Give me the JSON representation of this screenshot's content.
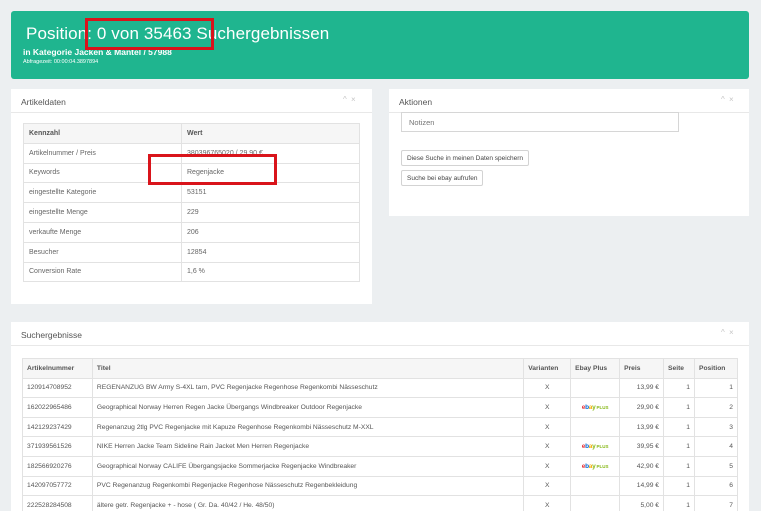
{
  "header": {
    "title": "Position: 0 von 35463 Suchergebnissen",
    "subtitle": "in Kategorie Jacken & Mäntel / 57988",
    "time": "Abfragezeit: 00:00:04.3897894"
  },
  "artikeldaten": {
    "title": "Artikeldaten",
    "controls": "^ ×",
    "headers": [
      "Kennzahl",
      "Wert"
    ],
    "rows": [
      {
        "key": "Artikelnummer / Preis",
        "value": "380396765020 / 29,90 €"
      },
      {
        "key": "Keywords",
        "value": "Regenjacke"
      },
      {
        "key": "eingestellte Kategorie",
        "value": "53151"
      },
      {
        "key": "eingestellte Menge",
        "value": "229"
      },
      {
        "key": "verkaufte Menge",
        "value": "206"
      },
      {
        "key": "Besucher",
        "value": "12854"
      },
      {
        "key": "Conversion Rate",
        "value": "1,6 %"
      }
    ]
  },
  "aktionen": {
    "title": "Aktionen",
    "controls": "^ ×",
    "notes_placeholder": "Notizen",
    "save_label": "Diese Suche in meinen Daten speichern",
    "ebay_label": "Suche bei ebay aufrufen"
  },
  "suchergebnisse": {
    "title": "Suchergebnisse",
    "controls": "^ ×",
    "headers": [
      "Artikelnummer",
      "Titel",
      "Varianten",
      "Ebay Plus",
      "Preis",
      "Seite",
      "Position"
    ],
    "ebay_plus_logo": {
      "e": "e",
      "b": "b",
      "a": "a",
      "y": "y",
      "plus": "PLUS"
    },
    "rows": [
      {
        "nr": "120914708952",
        "title": "REGENANZUG BW Army S-4XL tarn, PVC Regenjacke Regenhose Regenkombi Nässeschutz",
        "var": "X",
        "plus": false,
        "price": "13,99 €",
        "page": "1",
        "pos": "1"
      },
      {
        "nr": "162022965486",
        "title": "Geographical Norway Herren Regen Jacke Übergangs Windbreaker Outdoor Regenjacke",
        "var": "X",
        "plus": true,
        "price": "29,90 €",
        "page": "1",
        "pos": "2"
      },
      {
        "nr": "142129237429",
        "title": "Regenanzug 2tlg PVC Regenjacke mit Kapuze Regenhose Regenkombi Nässeschutz M-XXL",
        "var": "X",
        "plus": false,
        "price": "13,99 €",
        "page": "1",
        "pos": "3"
      },
      {
        "nr": "371939561526",
        "title": "NIKE Herren Jacke Team Sideline Rain Jacket Men Herren Regenjacke",
        "var": "X",
        "plus": true,
        "price": "39,95 €",
        "page": "1",
        "pos": "4"
      },
      {
        "nr": "182566920276",
        "title": "Geographical Norway CALIFE Übergangsjacke Sommerjacke Regenjacke Windbreaker",
        "var": "X",
        "plus": true,
        "price": "42,90 €",
        "page": "1",
        "pos": "5"
      },
      {
        "nr": "142097057772",
        "title": "PVC Regenanzug Regenkombi Regenjacke Regenhose Nässeschutz Regenbekleidung",
        "var": "X",
        "plus": false,
        "price": "14,99 €",
        "page": "1",
        "pos": "6"
      },
      {
        "nr": "222528284508",
        "title": "ältere getr. Regenjacke + - hose ( Gr. Da. 40/42 / He. 48/50)",
        "var": "X",
        "plus": false,
        "price": "5,00 €",
        "page": "1",
        "pos": "7"
      }
    ]
  },
  "colors": {
    "header_bg": "#1fb58f",
    "highlight": "#d9141b",
    "link": "#2a7bc1"
  }
}
